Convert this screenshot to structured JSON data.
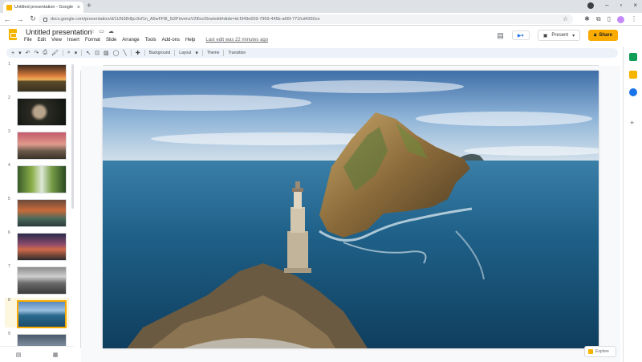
{
  "browser": {
    "tab_title": "Untitled presentation - Google S",
    "url": "docs.google.com/presentation/d/1UN38r8jcr3vf1n_A5wFF8l_5i2PrtvrmzV2l6xcf3rw/edit#slide=id.f349e659-7959-445b-a66f-771fcd4350ce"
  },
  "app": {
    "doc_title": "Untitled presentation",
    "menu": [
      "File",
      "Edit",
      "View",
      "Insert",
      "Format",
      "Slide",
      "Arrange",
      "Tools",
      "Add-ons",
      "Help"
    ],
    "last_edit": "Last edit was 22 minutes ago",
    "present_label": "Present",
    "share_label": "Share"
  },
  "toolbar": {
    "background_label": "Background",
    "layout_label": "Layout",
    "theme_label": "Theme",
    "transition_label": "Transition"
  },
  "filmstrip": {
    "slides": [
      {
        "number": "1",
        "scene": "savanna-sunset",
        "selected": false
      },
      {
        "number": "2",
        "scene": "owl",
        "selected": false
      },
      {
        "number": "3",
        "scene": "baobab",
        "selected": false
      },
      {
        "number": "4",
        "scene": "waterfall-forest",
        "selected": false
      },
      {
        "number": "5",
        "scene": "waterfalls",
        "selected": false
      },
      {
        "number": "6",
        "scene": "mountain-dusk",
        "selected": false
      },
      {
        "number": "7",
        "scene": "misty-mountains",
        "selected": false
      },
      {
        "number": "8",
        "scene": "lighthouse-sea",
        "selected": true
      },
      {
        "number": "9",
        "scene": "city",
        "selected": false
      }
    ]
  },
  "explore_label": "Explore",
  "colors": {
    "accent": "#f9ab00",
    "slides_yellow": "#f4b400",
    "sea": "#1d5f86",
    "sky": "#6f9fcf"
  }
}
